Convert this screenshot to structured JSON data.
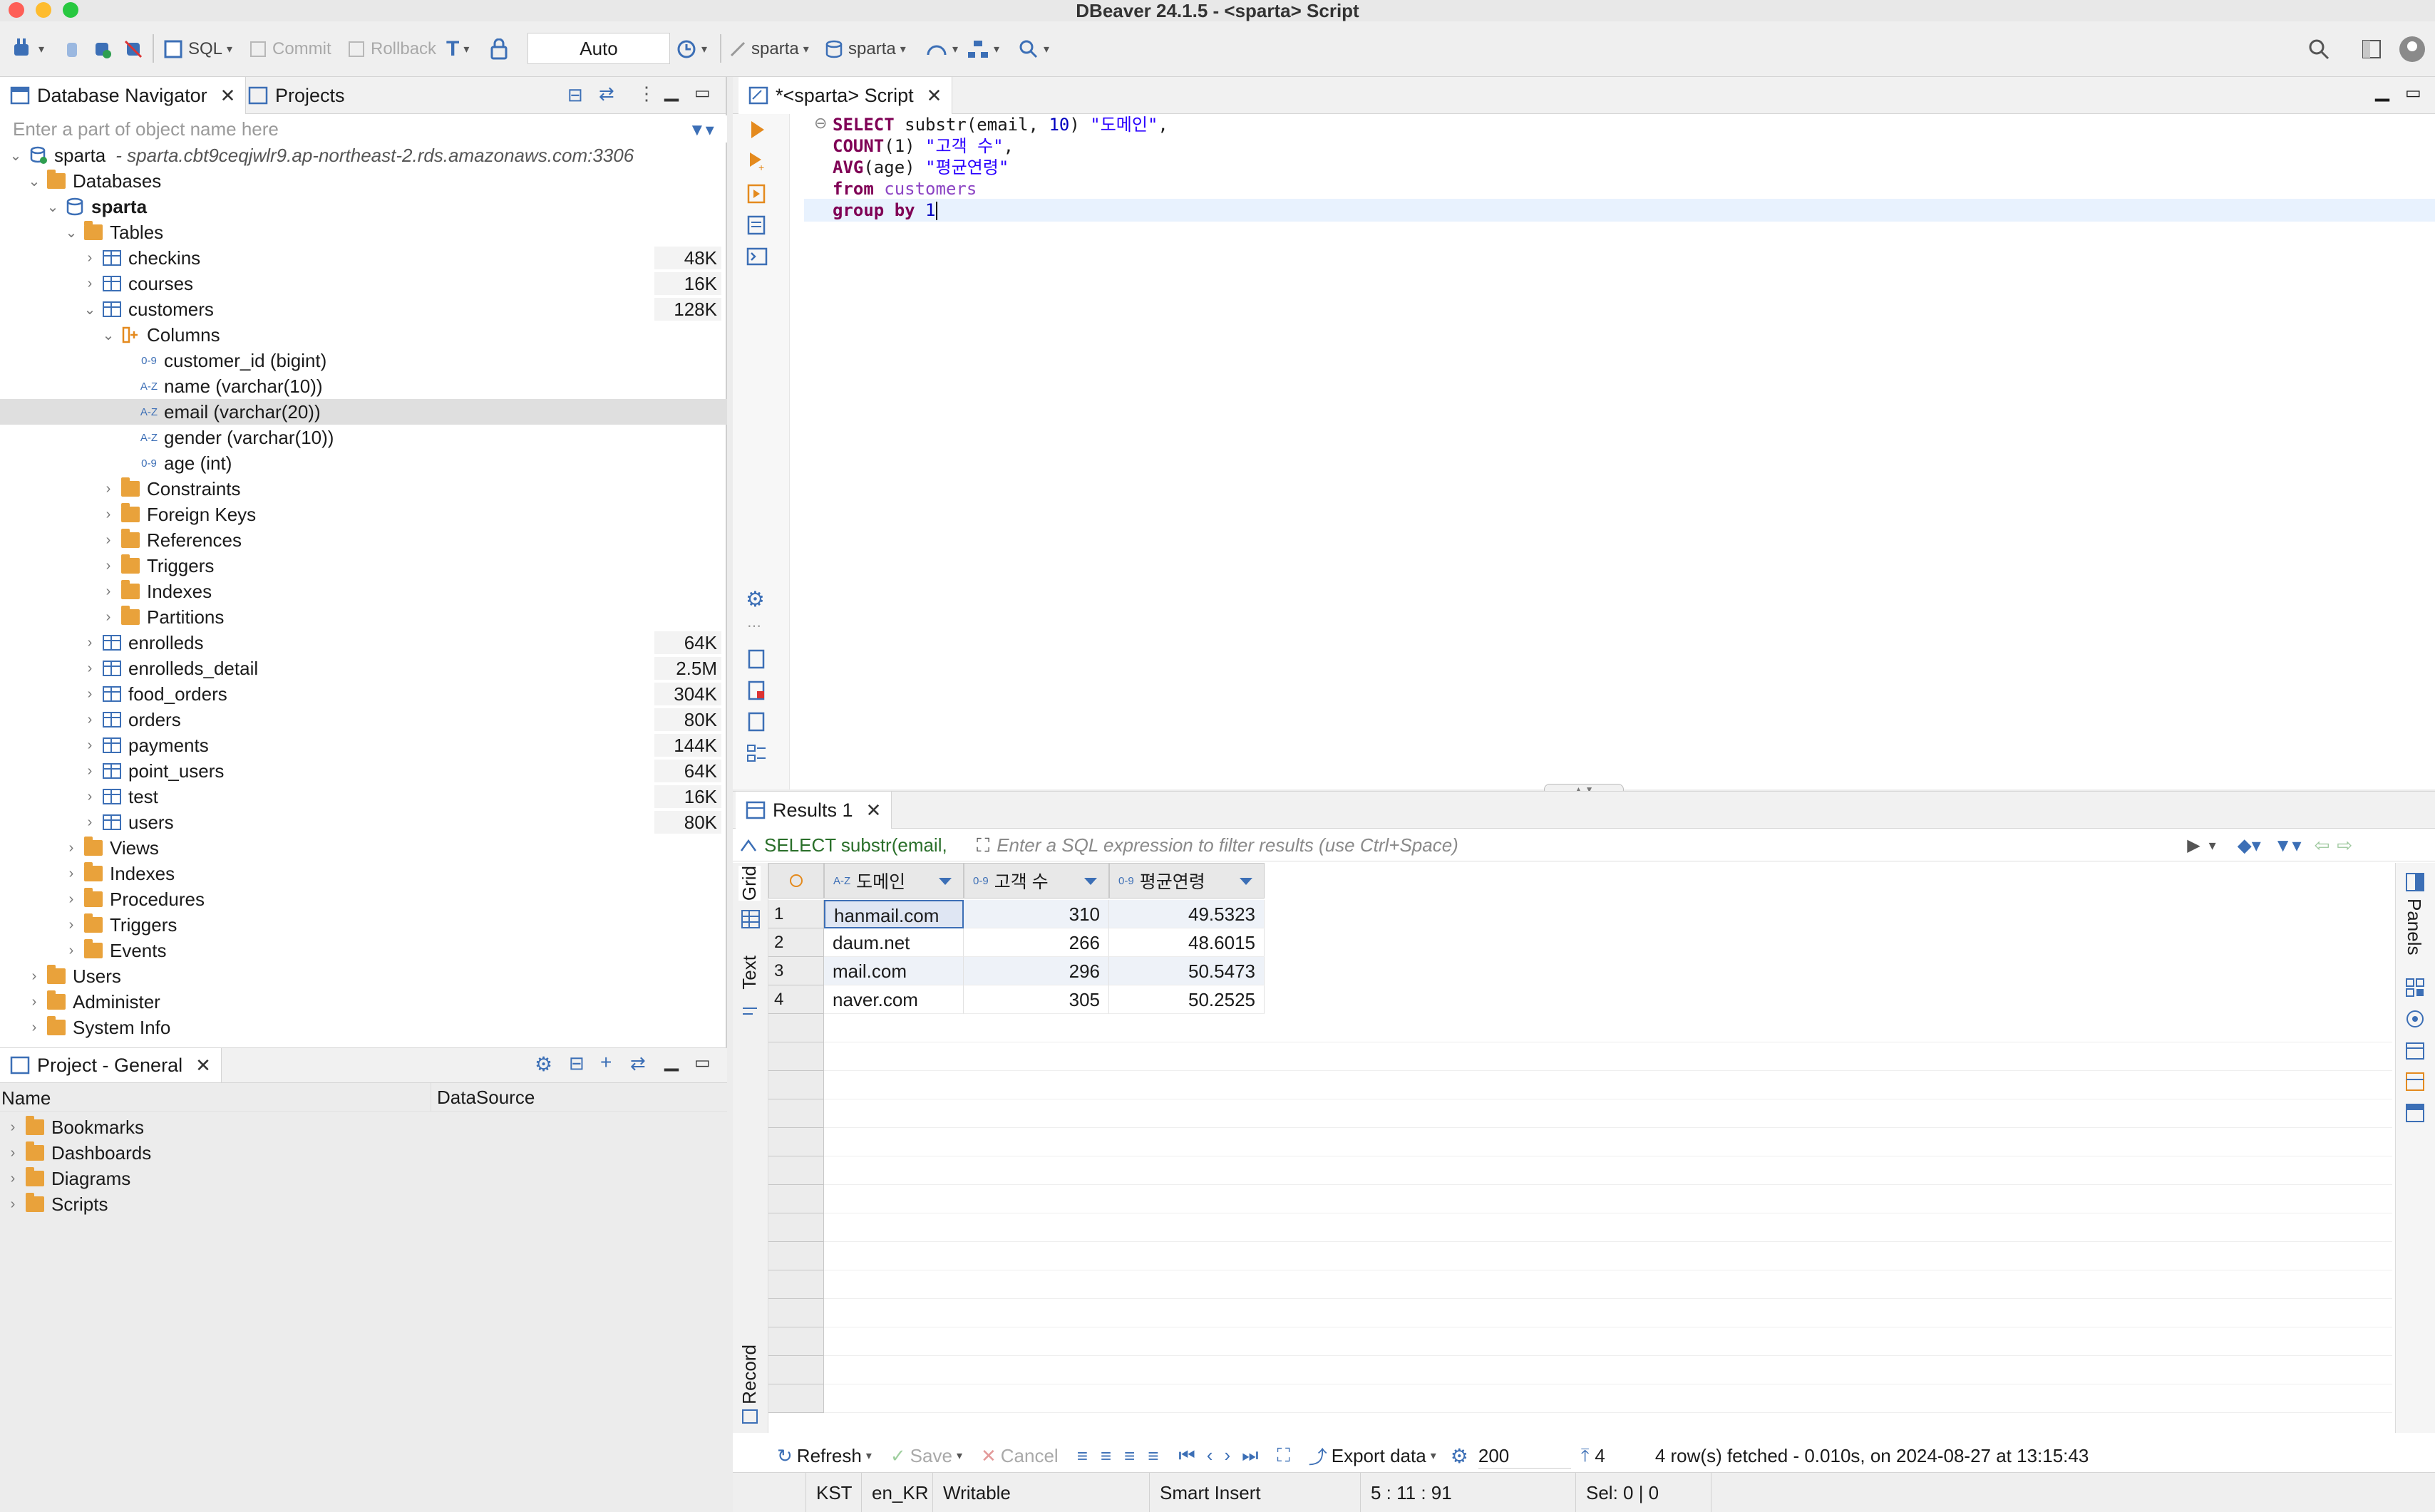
{
  "window": {
    "title": "DBeaver 24.1.5 - <sparta> Script"
  },
  "toolbar": {
    "sql_label": "SQL",
    "commit_label": "Commit",
    "rollback_label": "Rollback",
    "tx_mode": "Auto",
    "datasource_label": "sparta",
    "schema_label": "sparta"
  },
  "navigator": {
    "tab_navigator": "Database Navigator",
    "tab_projects": "Projects",
    "filter_placeholder": "Enter a part of object name here",
    "connection": {
      "name": "sparta",
      "host": "- sparta.cbt9ceqjwlr9.ap-northeast-2.rds.amazonaws.com:3306"
    },
    "databases_label": "Databases",
    "schema_name": "sparta",
    "tables_label": "Tables",
    "tables": [
      {
        "name": "checkins",
        "size": "48K"
      },
      {
        "name": "courses",
        "size": "16K"
      },
      {
        "name": "customers",
        "size": "128K"
      }
    ],
    "columns_label": "Columns",
    "columns": [
      {
        "type": "0-9",
        "label": "customer_id (bigint)"
      },
      {
        "type": "A-Z",
        "label": "name (varchar(10))"
      },
      {
        "type": "A-Z",
        "label": "email (varchar(20))"
      },
      {
        "type": "A-Z",
        "label": "gender (varchar(10))"
      },
      {
        "type": "0-9",
        "label": "age (int)"
      }
    ],
    "customer_children": [
      "Constraints",
      "Foreign Keys",
      "References",
      "Triggers",
      "Indexes",
      "Partitions"
    ],
    "tables_rest": [
      {
        "name": "enrolleds",
        "size": "64K"
      },
      {
        "name": "enrolleds_detail",
        "size": "2.5M"
      },
      {
        "name": "food_orders",
        "size": "304K"
      },
      {
        "name": "orders",
        "size": "80K"
      },
      {
        "name": "payments",
        "size": "144K"
      },
      {
        "name": "point_users",
        "size": "64K"
      },
      {
        "name": "test",
        "size": "16K"
      },
      {
        "name": "users",
        "size": "80K"
      }
    ],
    "schema_children": [
      "Views",
      "Indexes",
      "Procedures",
      "Triggers",
      "Events"
    ],
    "conn_children": [
      "Users",
      "Administer",
      "System Info"
    ]
  },
  "project": {
    "tab": "Project - General",
    "col_name": "Name",
    "col_datasource": "DataSource",
    "items": [
      "Bookmarks",
      "Dashboards",
      "Diagrams",
      "Scripts"
    ]
  },
  "editor": {
    "tab": "*<sparta> Script",
    "lines": [
      [
        {
          "t": "SELECT ",
          "c": "kw"
        },
        {
          "t": "substr(email, ",
          "c": ""
        },
        {
          "t": "10",
          "c": "num"
        },
        {
          "t": ") ",
          "c": ""
        },
        {
          "t": "\"도메인\"",
          "c": "str"
        },
        {
          "t": ",",
          "c": ""
        }
      ],
      [
        {
          "t": "COUNT",
          "c": "kw"
        },
        {
          "t": "(1) ",
          "c": ""
        },
        {
          "t": "\"고객 수\"",
          "c": "str"
        },
        {
          "t": ",",
          "c": ""
        }
      ],
      [
        {
          "t": "AVG",
          "c": "kw"
        },
        {
          "t": "(age) ",
          "c": ""
        },
        {
          "t": "\"평균연령\"",
          "c": "str"
        }
      ],
      [
        {
          "t": "from ",
          "c": "kw"
        },
        {
          "t": "customers",
          "c": "tblname"
        }
      ],
      [
        {
          "t": "group by ",
          "c": "kw"
        },
        {
          "t": "1",
          "c": "num"
        }
      ]
    ]
  },
  "results": {
    "tab": "Results 1",
    "query_preview": "SELECT substr(email,",
    "filter_placeholder": "Enter a SQL expression to filter results (use Ctrl+Space)",
    "side_tabs": [
      "Grid",
      "Text",
      "Record"
    ],
    "panels_label": "Panels",
    "columns": [
      {
        "type": "A-Z",
        "name": "도메인"
      },
      {
        "type": "0-9",
        "name": "고객 수"
      },
      {
        "type": "0-9",
        "name": "평균연령"
      }
    ],
    "rows": [
      {
        "n": "1",
        "domain": "hanmail.com",
        "count": "310",
        "avg": "49.5323"
      },
      {
        "n": "2",
        "domain": "daum.net",
        "count": "266",
        "avg": "48.6015"
      },
      {
        "n": "3",
        "domain": "mail.com",
        "count": "296",
        "avg": "50.5473"
      },
      {
        "n": "4",
        "domain": "naver.com",
        "count": "305",
        "avg": "50.2525"
      }
    ],
    "bottom": {
      "refresh": "Refresh",
      "save": "Save",
      "cancel": "Cancel",
      "export": "Export data",
      "fetch_size": "200",
      "row_count": "4",
      "status": "4 row(s) fetched - 0.010s, on 2024-08-27 at 13:15:43"
    }
  },
  "statusbar": {
    "tz": "KST",
    "locale": "en_KR",
    "mode": "Writable",
    "insert": "Smart Insert",
    "pos": "5 : 11 : 91",
    "sel": "Sel: 0 | 0"
  },
  "colors": {
    "accent": "#3c6fb6",
    "folder": "#e9a23b",
    "keyword": "#7f0055",
    "string": "#2a00ff"
  }
}
